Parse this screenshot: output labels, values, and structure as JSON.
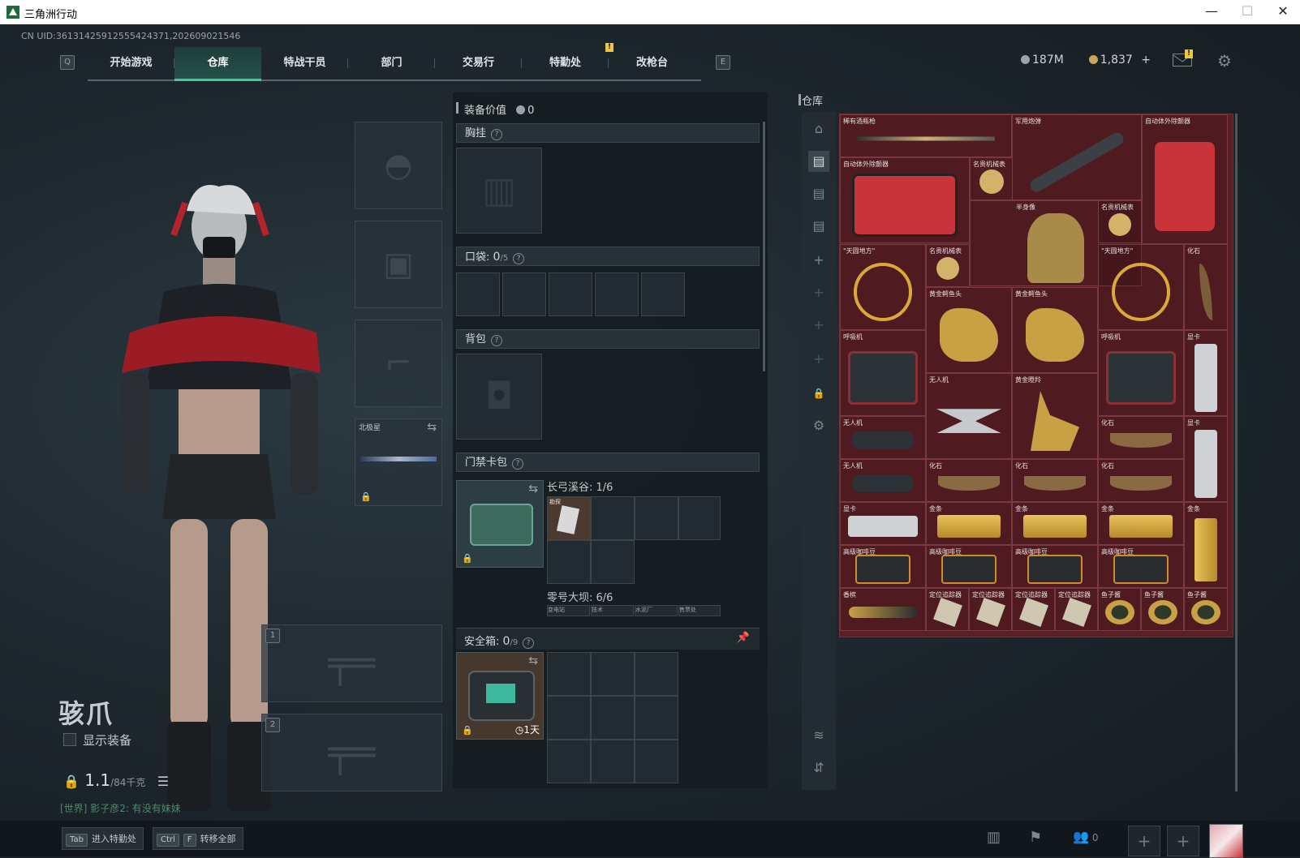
{
  "window": {
    "title": "三角洲行动",
    "controls": [
      "—",
      "☐",
      "✕"
    ]
  },
  "uid": "CN UID:3613142591255542437​1,202609021546",
  "nav": {
    "key_left": "Q",
    "key_right": "E",
    "tabs": [
      "开始游戏",
      "仓库",
      "特战干员",
      "部门",
      "交易行",
      "特勤处",
      "改枪台"
    ],
    "active_tab": "仓库",
    "alert_mark": "!"
  },
  "currency": {
    "silver": "187M",
    "gold": "1,837",
    "plus": "+",
    "mail_alert": "!"
  },
  "character": {
    "name": "骇爪",
    "show_equipment_label": "显示装备",
    "weight_value": "1.1",
    "weight_max": "/84千克",
    "chat_channel": "[世界]",
    "chat_text": "影子彦2: 有没有妹妹"
  },
  "equip": {
    "melee_name": "北极星",
    "weapon_slot_1": "1",
    "weapon_slot_2": "2"
  },
  "middle": {
    "value_label": "装备价值",
    "value_amount": "0",
    "chest_label": "胸挂",
    "pocket_label": "口袋:",
    "pocket_count": "0",
    "pocket_max": "/5",
    "backpack_label": "背包",
    "keycard_label": "门禁卡包",
    "key_zone_1": "长弓溪谷: 1/6",
    "key_zone_2": "零号大坝: 6/6",
    "key_item_tag": "勘探",
    "key_subtabs": [
      "变电站",
      "技术",
      "水泥厂",
      "售票处"
    ],
    "safe_label": "安全箱:",
    "safe_count": "0",
    "safe_max": "/9",
    "safe_time": "1天",
    "help": "?"
  },
  "warehouse": {
    "title": "仓库",
    "items": [
      {
        "label": "稀有酒瓶枪"
      },
      {
        "label": "军用炮弹"
      },
      {
        "label": "自动体外除颤器"
      },
      {
        "label": "自动体外除颤器"
      },
      {
        "label": "名贵机械表"
      },
      {
        "label": "半身像"
      },
      {
        "label": "名贵机械表"
      },
      {
        "label": "\"天圆地方\""
      },
      {
        "label": "名贵机械表"
      },
      {
        "label": "\"天圆地方\""
      },
      {
        "label": "化石"
      },
      {
        "label": "黄金鳄鱼头"
      },
      {
        "label": "黄金鳄鱼头"
      },
      {
        "label": "呼吸机"
      },
      {
        "label": "呼吸机"
      },
      {
        "label": "显卡"
      },
      {
        "label": "无人机"
      },
      {
        "label": "黄金瞪羚"
      },
      {
        "label": "无人机"
      },
      {
        "label": "化石"
      },
      {
        "label": "显卡"
      },
      {
        "label": "无人机"
      },
      {
        "label": "化石"
      },
      {
        "label": "化石"
      },
      {
        "label": "化石"
      },
      {
        "label": "显卡"
      },
      {
        "label": "金条"
      },
      {
        "label": "金条"
      },
      {
        "label": "金条"
      },
      {
        "label": "金条"
      },
      {
        "label": "高级咖啡豆"
      },
      {
        "label": "高级咖啡豆"
      },
      {
        "label": "高级咖啡豆"
      },
      {
        "label": "高级咖啡豆"
      },
      {
        "label": "香槟"
      },
      {
        "label": "定位追踪器"
      },
      {
        "label": "定位追踪器"
      },
      {
        "label": "定位追踪器"
      },
      {
        "label": "定位追踪器"
      },
      {
        "label": "鱼子酱"
      },
      {
        "label": "鱼子酱"
      },
      {
        "label": "鱼子酱"
      }
    ]
  },
  "bottom": {
    "tab_key": "Tab",
    "tab_label": "进入特勤处",
    "ctrl_key": "Ctrl",
    "f_key": "F",
    "transfer_label": "转移全部",
    "friends_count": "0"
  },
  "colors": {
    "accent": "#3bd08f",
    "warehouse_bg": "#5b1f26",
    "alert": "#f2c541"
  }
}
